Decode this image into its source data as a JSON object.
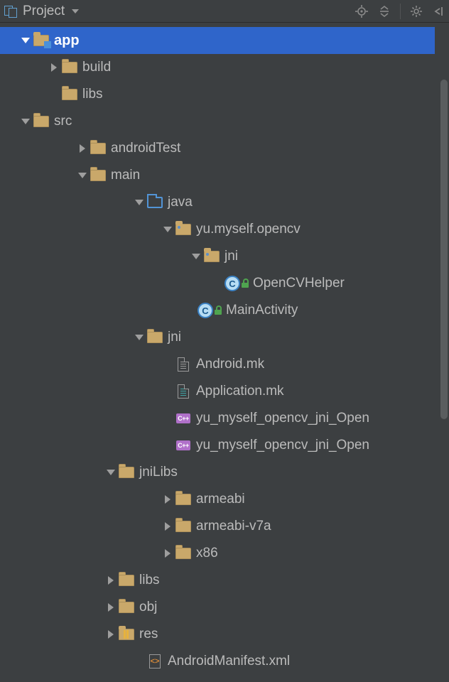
{
  "header": {
    "title": "Project",
    "tools": {
      "dropdown": "dropdown",
      "target": "target",
      "collapse": "collapse",
      "settings": "settings",
      "hide": "hide"
    }
  },
  "tree": {
    "app": "app",
    "build": "build",
    "libs_top": "libs",
    "src": "src",
    "androidTest": "androidTest",
    "main": "main",
    "java": "java",
    "pkg": "yu.myself.opencv",
    "jni_pkg": "jni",
    "OpenCVHelper": "OpenCVHelper",
    "MainActivity": "MainActivity",
    "jni_dir": "jni",
    "Android_mk": "Android.mk",
    "Application_mk": "Application.mk",
    "cpp1": "yu_myself_opencv_jni_Open",
    "cpp2": "yu_myself_opencv_jni_Open",
    "jniLibs": "jniLibs",
    "armeabi": "armeabi",
    "armeabi_v7a": "armeabi-v7a",
    "x86": "x86",
    "libs": "libs",
    "obj": "obj",
    "res": "res",
    "manifest": "AndroidManifest.xml"
  }
}
